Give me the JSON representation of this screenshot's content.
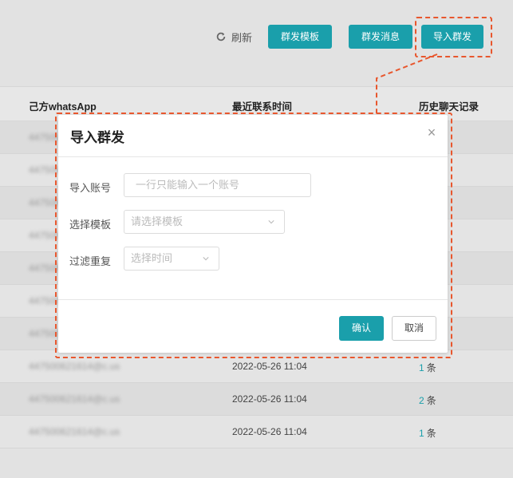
{
  "toolbar": {
    "refresh_label": "刷新",
    "template_button": "群发模板",
    "message_button": "群发消息",
    "import_button": "导入群发"
  },
  "table": {
    "headers": [
      "己方whatsApp",
      "最近联系时间",
      "历史聊天记录"
    ],
    "rows": [
      {
        "account": "447500621614@c.us",
        "time": "",
        "count": "",
        "unit": ""
      },
      {
        "account": "447500621614@c.us",
        "time": "",
        "count": "",
        "unit": ""
      },
      {
        "account": "447500621614@c.us",
        "time": "",
        "count": "",
        "unit": ""
      },
      {
        "account": "447500621614@c.us",
        "time": "",
        "count": "",
        "unit": ""
      },
      {
        "account": "447500621614@c.us",
        "time": "",
        "count": "",
        "unit": ""
      },
      {
        "account": "447500621614@c.us",
        "time": "",
        "count": "",
        "unit": ""
      },
      {
        "account": "447500621614@c.us",
        "time": "",
        "count": "",
        "unit": ""
      },
      {
        "account": "447500621614@c.us",
        "time": "2022-05-26 11:04",
        "count": "1",
        "unit": "条"
      },
      {
        "account": "447500621614@c.us",
        "time": "2022-05-26 11:04",
        "count": "2",
        "unit": "条"
      },
      {
        "account": "447500621614@c.us",
        "time": "2022-05-26 11:04",
        "count": "1",
        "unit": "条"
      }
    ]
  },
  "modal": {
    "title": "导入群发",
    "close_symbol": "×",
    "account_label": "导入账号",
    "account_placeholder": "一行只能输入一个账号",
    "template_label": "选择模板",
    "template_placeholder": "请选择模板",
    "filter_label": "过滤重复",
    "filter_placeholder": "选择时间",
    "confirm_label": "确认",
    "cancel_label": "取消"
  },
  "colors": {
    "accent": "#1a9fab",
    "highlight": "#e8572e"
  }
}
